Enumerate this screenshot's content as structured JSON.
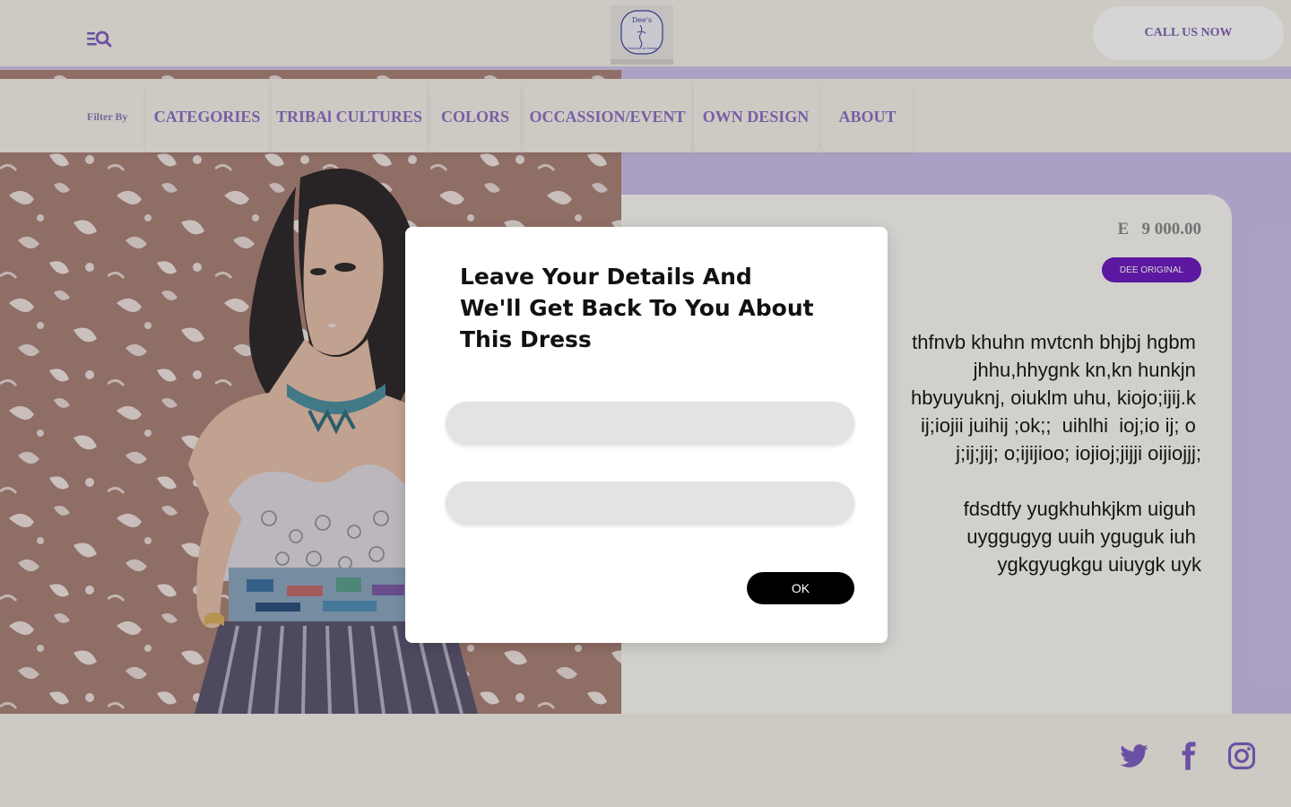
{
  "header": {
    "call_label": "CALL US NOW",
    "logo_text": "Dee's",
    "logo_subtext": "Creations in Design"
  },
  "filter": {
    "label": "Filter By",
    "items": [
      {
        "label": "CATEGORIES"
      },
      {
        "label": "TRIBAl CULTURES"
      },
      {
        "label": "COLORS"
      },
      {
        "label": "OCCASSION/EVENT"
      },
      {
        "label": "OWN DESIGN"
      },
      {
        "label": "ABOUT"
      }
    ]
  },
  "product": {
    "price": "E   9 000.00",
    "badge": "DEE ORIGINAL",
    "description": [
      "thfnvb khuhn mvtcnh bhjbj hgbm ",
      "jhhu,hhygnk kn,kn hunkjn ",
      "hbyuyuknj, oiuklm uhu, kiojo;ijij.k ",
      "ij;iojii juihij ;ok;;  uihlhi  ioj;io ij; o ",
      "j;ij;jij; o;ijijioo; iojioj;jijji oijiojjj;",
      "",
      "fdsdtfy yugkhuhkjkm uiguh ",
      "uyggugyg uuih yguguk iuh ",
      "ygkgyugkgu uiuygk uyk"
    ]
  },
  "modal": {
    "title": "Leave Your Details And We'll Get Back To You About This Dress",
    "input1_value": "",
    "input2_value": "",
    "ok_label": "OK"
  },
  "colors": {
    "accent_purple": "#8a70c6",
    "badge_purple": "#6b19bf",
    "lavender": "#cbbfe9",
    "cream": "#f4f1e9"
  },
  "icons": [
    "menu-search-icon",
    "twitter-icon",
    "facebook-icon",
    "instagram-icon"
  ]
}
